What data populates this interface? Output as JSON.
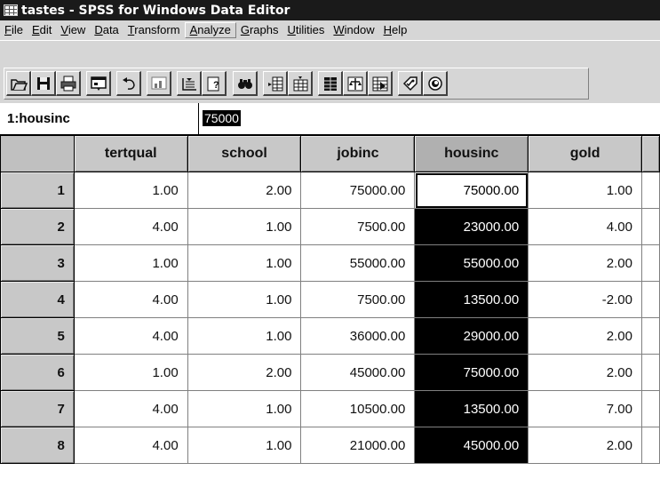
{
  "window": {
    "title": "tastes - SPSS for Windows Data Editor"
  },
  "menu": {
    "items": [
      {
        "label": "File",
        "ul": "F",
        "rest": "ile"
      },
      {
        "label": "Edit",
        "ul": "E",
        "rest": "dit"
      },
      {
        "label": "View",
        "ul": "V",
        "rest": "iew"
      },
      {
        "label": "Data",
        "ul": "D",
        "rest": "ata"
      },
      {
        "label": "Transform",
        "ul": "T",
        "rest": "ransform"
      },
      {
        "label": "Analyze",
        "ul": "A",
        "rest": "nalyze"
      },
      {
        "label": "Graphs",
        "ul": "G",
        "rest": "raphs"
      },
      {
        "label": "Utilities",
        "ul": "U",
        "rest": "tilities"
      },
      {
        "label": "Window",
        "ul": "W",
        "rest": "indow"
      },
      {
        "label": "Help",
        "ul": "H",
        "rest": "elp"
      }
    ]
  },
  "toolbar": {
    "buttons": [
      "open-file-icon",
      "save-icon",
      "print-icon",
      "dialog-recall-icon",
      "undo-icon",
      "goto-chart-icon",
      "goto-case-icon",
      "variables-icon",
      "find-icon",
      "insert-case-icon",
      "insert-variable-icon",
      "split-file-icon",
      "weight-cases-icon",
      "select-cases-icon",
      "value-labels-icon",
      "use-sets-icon"
    ]
  },
  "cell_editor": {
    "reference": "1:housinc",
    "value": "75000"
  },
  "grid": {
    "columns": [
      "tertqual",
      "school",
      "jobinc",
      "housinc",
      "gold"
    ],
    "rows": [
      {
        "num": "1",
        "cells": [
          "1.00",
          "2.00",
          "75000.00",
          "75000.00",
          "1.00"
        ]
      },
      {
        "num": "2",
        "cells": [
          "4.00",
          "1.00",
          "7500.00",
          "23000.00",
          "4.00"
        ]
      },
      {
        "num": "3",
        "cells": [
          "1.00",
          "1.00",
          "55000.00",
          "55000.00",
          "2.00"
        ]
      },
      {
        "num": "4",
        "cells": [
          "4.00",
          "1.00",
          "7500.00",
          "13500.00",
          "-2.00"
        ]
      },
      {
        "num": "5",
        "cells": [
          "4.00",
          "1.00",
          "36000.00",
          "29000.00",
          "2.00"
        ]
      },
      {
        "num": "6",
        "cells": [
          "1.00",
          "2.00",
          "45000.00",
          "75000.00",
          "2.00"
        ]
      },
      {
        "num": "7",
        "cells": [
          "4.00",
          "1.00",
          "10500.00",
          "13500.00",
          "7.00"
        ]
      },
      {
        "num": "8",
        "cells": [
          "4.00",
          "1.00",
          "21000.00",
          "45000.00",
          "2.00"
        ]
      }
    ]
  },
  "colors": {
    "chrome": "#d6d6d6",
    "title_bar": "#1a1a1a",
    "selection": "#000000"
  }
}
